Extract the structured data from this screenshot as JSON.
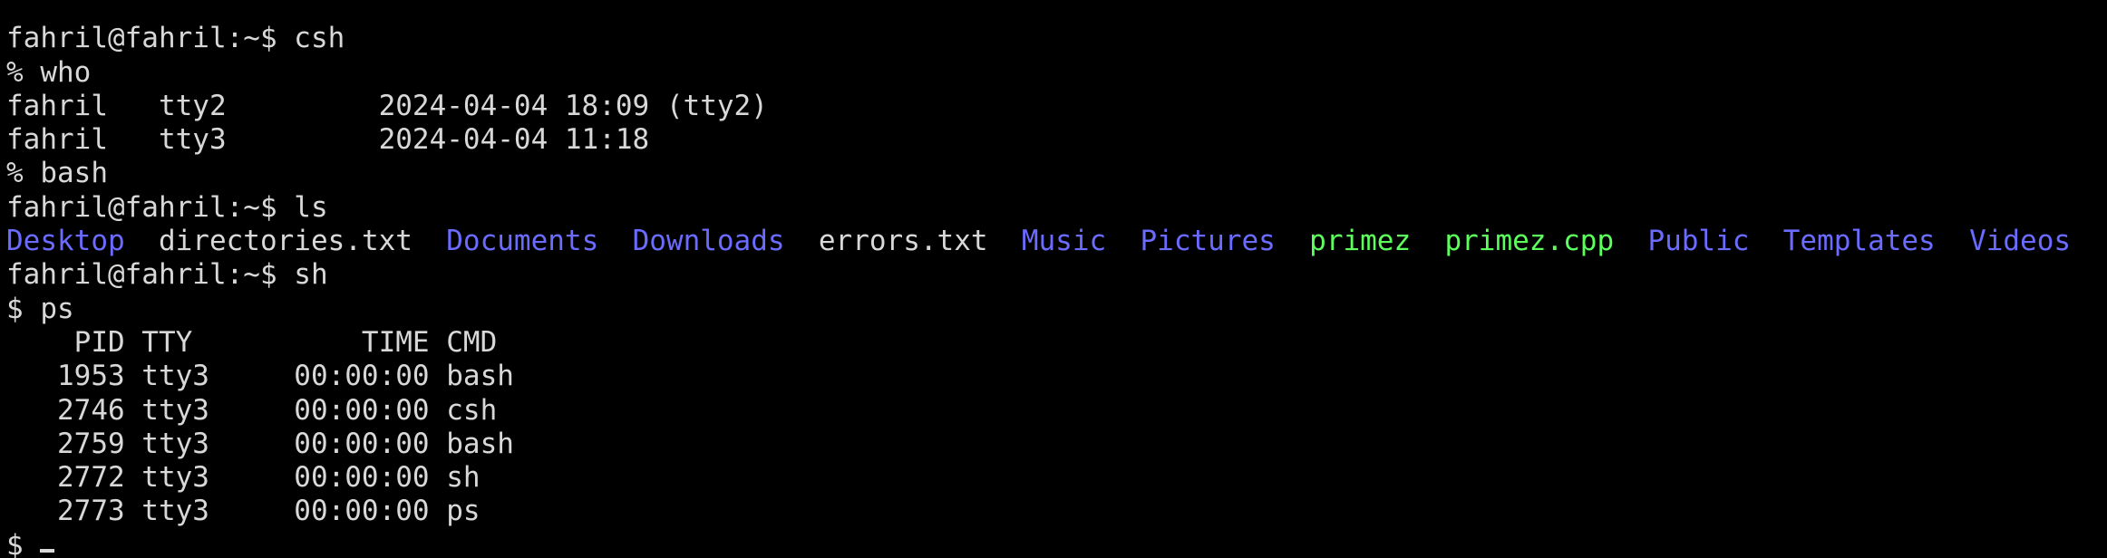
{
  "colors": {
    "background": "#000000",
    "text": "#d8d8d8",
    "directory": "#6b6bff",
    "executable": "#5cff5c"
  },
  "lines": [
    {
      "segments": [
        {
          "text": "                               ",
          "color": "default"
        }
      ]
    },
    {
      "segments": [
        {
          "text": "fahril@fahril:~$ csh",
          "color": "default"
        }
      ]
    },
    {
      "segments": [
        {
          "text": "% who",
          "color": "default"
        }
      ]
    },
    {
      "segments": [
        {
          "text": "fahril   tty2         2024-04-04 18:09 (tty2)",
          "color": "default"
        }
      ]
    },
    {
      "segments": [
        {
          "text": "fahril   tty3         2024-04-04 11:18",
          "color": "default"
        }
      ]
    },
    {
      "segments": [
        {
          "text": "% bash",
          "color": "default"
        }
      ]
    },
    {
      "segments": [
        {
          "text": "fahril@fahril:~$ ls",
          "color": "default"
        }
      ]
    },
    {
      "segments": [
        {
          "text": "Desktop",
          "color": "dir"
        },
        {
          "text": "  directories.txt  ",
          "color": "default"
        },
        {
          "text": "Documents",
          "color": "dir"
        },
        {
          "text": "  ",
          "color": "default"
        },
        {
          "text": "Downloads",
          "color": "dir"
        },
        {
          "text": "  errors.txt  ",
          "color": "default"
        },
        {
          "text": "Music",
          "color": "dir"
        },
        {
          "text": "  ",
          "color": "default"
        },
        {
          "text": "Pictures",
          "color": "dir"
        },
        {
          "text": "  ",
          "color": "default"
        },
        {
          "text": "primez",
          "color": "exec"
        },
        {
          "text": "  ",
          "color": "default"
        },
        {
          "text": "primez.cpp",
          "color": "exec"
        },
        {
          "text": "  ",
          "color": "default"
        },
        {
          "text": "Public",
          "color": "dir"
        },
        {
          "text": "  ",
          "color": "default"
        },
        {
          "text": "Templates",
          "color": "dir"
        },
        {
          "text": "  ",
          "color": "default"
        },
        {
          "text": "Videos",
          "color": "dir"
        }
      ]
    },
    {
      "segments": [
        {
          "text": "fahril@fahril:~$ sh",
          "color": "default"
        }
      ]
    },
    {
      "segments": [
        {
          "text": "$ ps",
          "color": "default"
        }
      ]
    },
    {
      "segments": [
        {
          "text": "    PID TTY          TIME CMD",
          "color": "default"
        }
      ]
    },
    {
      "segments": [
        {
          "text": "   1953 tty3     00:00:00 bash",
          "color": "default"
        }
      ]
    },
    {
      "segments": [
        {
          "text": "   2746 tty3     00:00:00 csh",
          "color": "default"
        }
      ]
    },
    {
      "segments": [
        {
          "text": "   2759 tty3     00:00:00 bash",
          "color": "default"
        }
      ]
    },
    {
      "segments": [
        {
          "text": "   2772 tty3     00:00:00 sh",
          "color": "default"
        }
      ]
    },
    {
      "segments": [
        {
          "text": "   2773 tty3     00:00:00 ps",
          "color": "default"
        }
      ]
    },
    {
      "segments": [
        {
          "text": "$ ",
          "color": "default"
        }
      ],
      "cursor": true
    }
  ]
}
